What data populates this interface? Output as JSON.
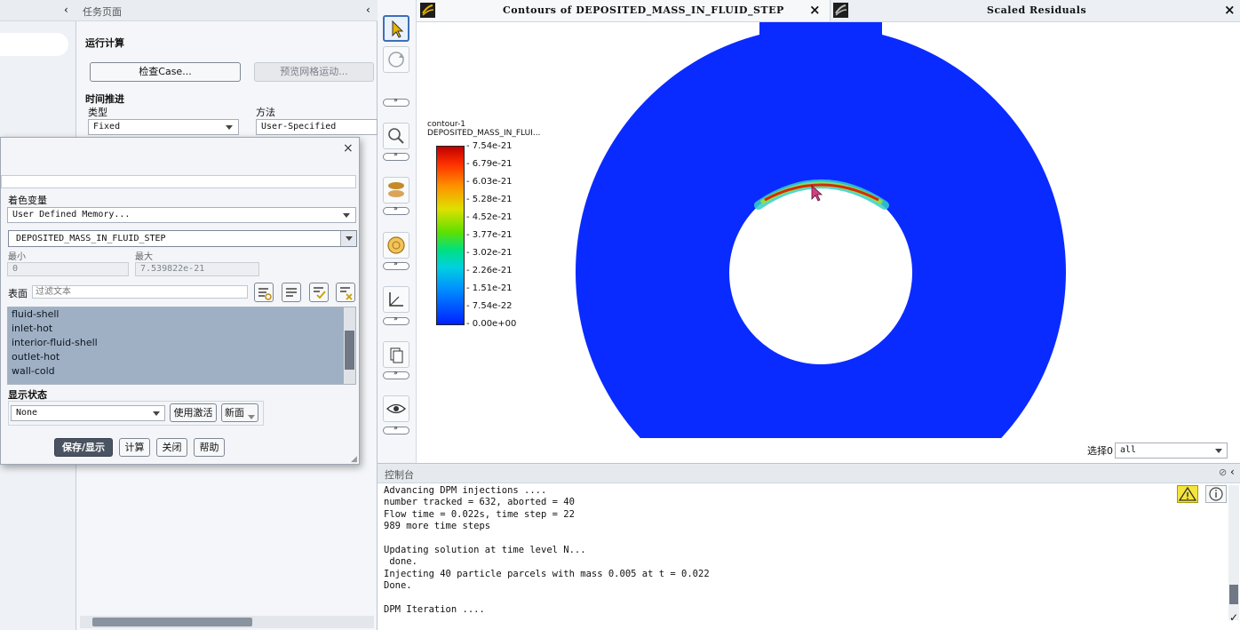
{
  "task_page": {
    "title": "任务页面",
    "section_title": "运行计算",
    "check_case_label": "检查Case...",
    "preview_mesh_label": "预览网格运动...",
    "time_stepping_label": "时间推进",
    "type_label": "类型",
    "type_value": "Fixed",
    "method_label": "方法",
    "method_value": "User-Specified"
  },
  "dialog": {
    "color_var_label": "着色变量",
    "color_var_value": "User Defined Memory...",
    "field_value": "DEPOSITED_MASS_IN_FLUID_STEP",
    "min_label": "最小",
    "max_label": "最大",
    "min_value": "0",
    "max_value": "7.539822e-21",
    "surfaces_label": "表面",
    "filter_placeholder": "过滤文本",
    "surfaces": [
      "fluid-shell",
      "inlet-hot",
      "interior-fluid-shell",
      "outlet-hot",
      "wall-cold"
    ],
    "display_state_label": "显示状态",
    "display_state_value": "None",
    "use_active_label": "使用激活",
    "new_label": "新面",
    "buttons": {
      "save_display": "保存/显示",
      "compute": "计算",
      "close": "关闭",
      "help": "帮助"
    }
  },
  "graphics": {
    "tab1_title": "Contours of DEPOSITED_MASS_IN_FLUID_STEP",
    "tab2_title": "Scaled Residuals",
    "legend_title1": "contour-1",
    "legend_title2": "DEPOSITED_MASS_IN_FLUI...",
    "legend_values": [
      "7.54e-21",
      "6.79e-21",
      "6.03e-21",
      "5.28e-21",
      "4.52e-21",
      "3.77e-21",
      "3.02e-21",
      "2.26e-21",
      "1.51e-21",
      "7.54e-22",
      "0.00e+00"
    ],
    "select_label": "选择0",
    "select_value": "all",
    "colors": {
      "domain": "#0a2bff",
      "deposit": "#d42a10"
    }
  },
  "console": {
    "title": "控制台",
    "lines": [
      "Advancing DPM injections ....",
      "number tracked = 632, aborted = 40",
      "Flow time = 0.022s, time step = 22",
      "989 more time steps",
      "",
      "Updating solution at time level N...",
      " done.",
      "Injecting 40 particle parcels with mass 0.005 at t = 0.022",
      "Done.",
      "",
      "DPM Iteration ...."
    ]
  }
}
